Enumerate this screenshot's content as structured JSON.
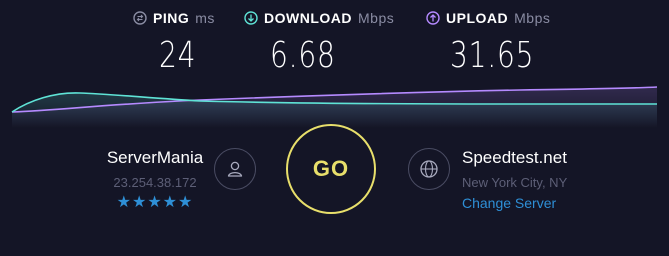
{
  "stats": {
    "ping": {
      "label": "PING",
      "unit": "ms",
      "value": "24",
      "icon": "ping-icon",
      "color": "#8a8ca3"
    },
    "download": {
      "label": "DOWNLOAD",
      "unit": "Mbps",
      "value": "6.68",
      "icon": "download-arrow-icon",
      "color": "#5fe3d6"
    },
    "upload": {
      "label": "UPLOAD",
      "unit": "Mbps",
      "value": "31.65",
      "icon": "upload-arrow-icon",
      "color": "#b58aff"
    }
  },
  "go_button": {
    "label": "GO",
    "color": "#e8df6b"
  },
  "host": {
    "name": "ServerMania",
    "ip": "23.254.38.172",
    "rating": "★★★★★",
    "icon": "user-icon"
  },
  "server": {
    "name": "Speedtest.net",
    "location": "New York City, NY",
    "change_label": "Change Server",
    "icon": "globe-icon"
  },
  "colors": {
    "background": "#141526",
    "accent_link": "#2e8fd6"
  }
}
